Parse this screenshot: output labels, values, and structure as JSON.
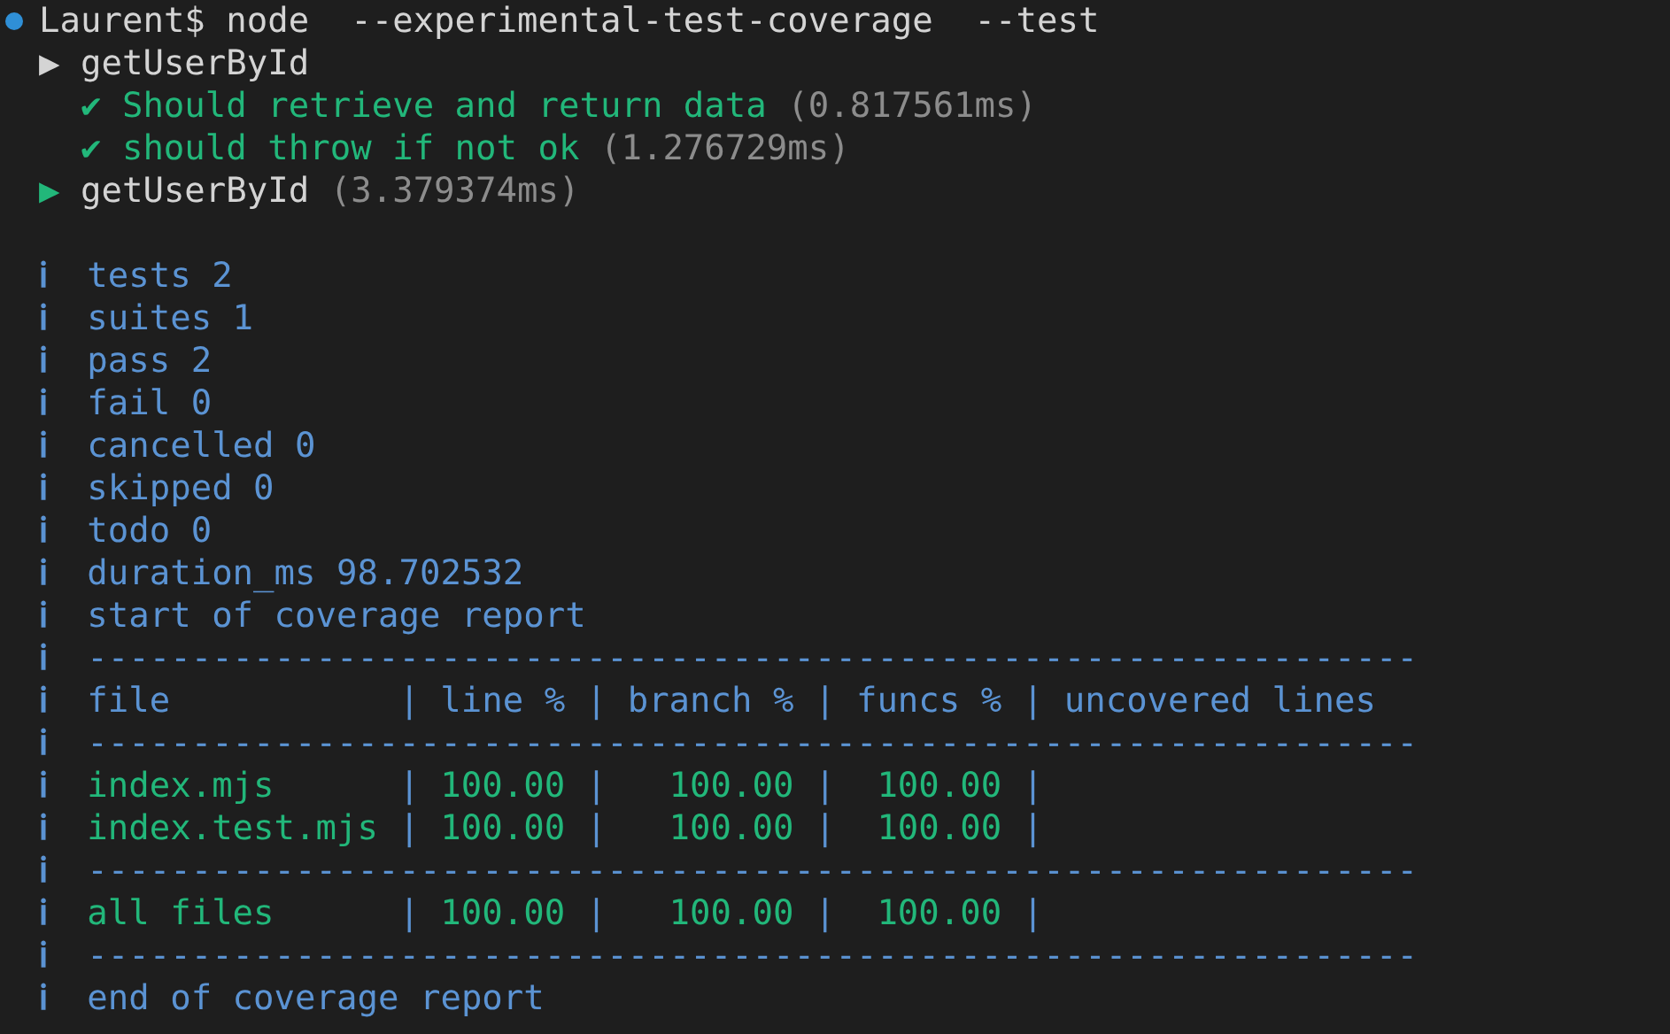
{
  "prompt": {
    "user": "Laurent$",
    "command": "node  --experimental-test-coverage  --test"
  },
  "lines": [
    {
      "kind": "suite",
      "marker": "▶",
      "name": "getUserById",
      "passed": false
    },
    {
      "kind": "test",
      "marker": "✔",
      "name": "Should retrieve and return data",
      "duration": "(0.817561ms)"
    },
    {
      "kind": "test",
      "marker": "✔",
      "name": "should throw if not ok",
      "duration": "(1.276729ms)"
    },
    {
      "kind": "suite",
      "marker": "▶",
      "name": "getUserById",
      "duration": "(3.379374ms)",
      "passed": true
    },
    {
      "kind": "blank"
    },
    {
      "kind": "info",
      "marker": "ℹ",
      "text": "tests 2"
    },
    {
      "kind": "info",
      "marker": "ℹ",
      "text": "suites 1"
    },
    {
      "kind": "info",
      "marker": "ℹ",
      "text": "pass 2"
    },
    {
      "kind": "info",
      "marker": "ℹ",
      "text": "fail 0"
    },
    {
      "kind": "info",
      "marker": "ℹ",
      "text": "cancelled 0"
    },
    {
      "kind": "info",
      "marker": "ℹ",
      "text": "skipped 0"
    },
    {
      "kind": "info",
      "marker": "ℹ",
      "text": "todo 0"
    },
    {
      "kind": "info",
      "marker": "ℹ",
      "text": "duration_ms 98.702532"
    },
    {
      "kind": "info",
      "marker": "ℹ",
      "text": "start of coverage report"
    },
    {
      "kind": "rule",
      "marker": "ℹ",
      "text": "----------------------------------------------------------------"
    },
    {
      "kind": "table-header",
      "marker": "ℹ",
      "cells": [
        "file",
        "|",
        "line %",
        "|",
        "branch %",
        "|",
        "funcs %",
        "|",
        "uncovered lines"
      ]
    },
    {
      "kind": "rule",
      "marker": "ℹ",
      "text": "----------------------------------------------------------------"
    },
    {
      "kind": "table-row",
      "marker": "ℹ",
      "cells": [
        "index.mjs",
        "|",
        "100.00",
        "|",
        "100.00",
        "|",
        "100.00",
        "|"
      ]
    },
    {
      "kind": "table-row",
      "marker": "ℹ",
      "cells": [
        "index.test.mjs",
        "|",
        "100.00",
        "|",
        "100.00",
        "|",
        "100.00",
        "|"
      ]
    },
    {
      "kind": "rule",
      "marker": "ℹ",
      "text": "----------------------------------------------------------------"
    },
    {
      "kind": "table-row",
      "marker": "ℹ",
      "cells": [
        "all files",
        "|",
        "100.00",
        "|",
        "100.00",
        "|",
        "100.00",
        "|"
      ]
    },
    {
      "kind": "rule",
      "marker": "ℹ",
      "text": "----------------------------------------------------------------"
    },
    {
      "kind": "info",
      "marker": "ℹ",
      "text": "end of coverage report"
    }
  ]
}
